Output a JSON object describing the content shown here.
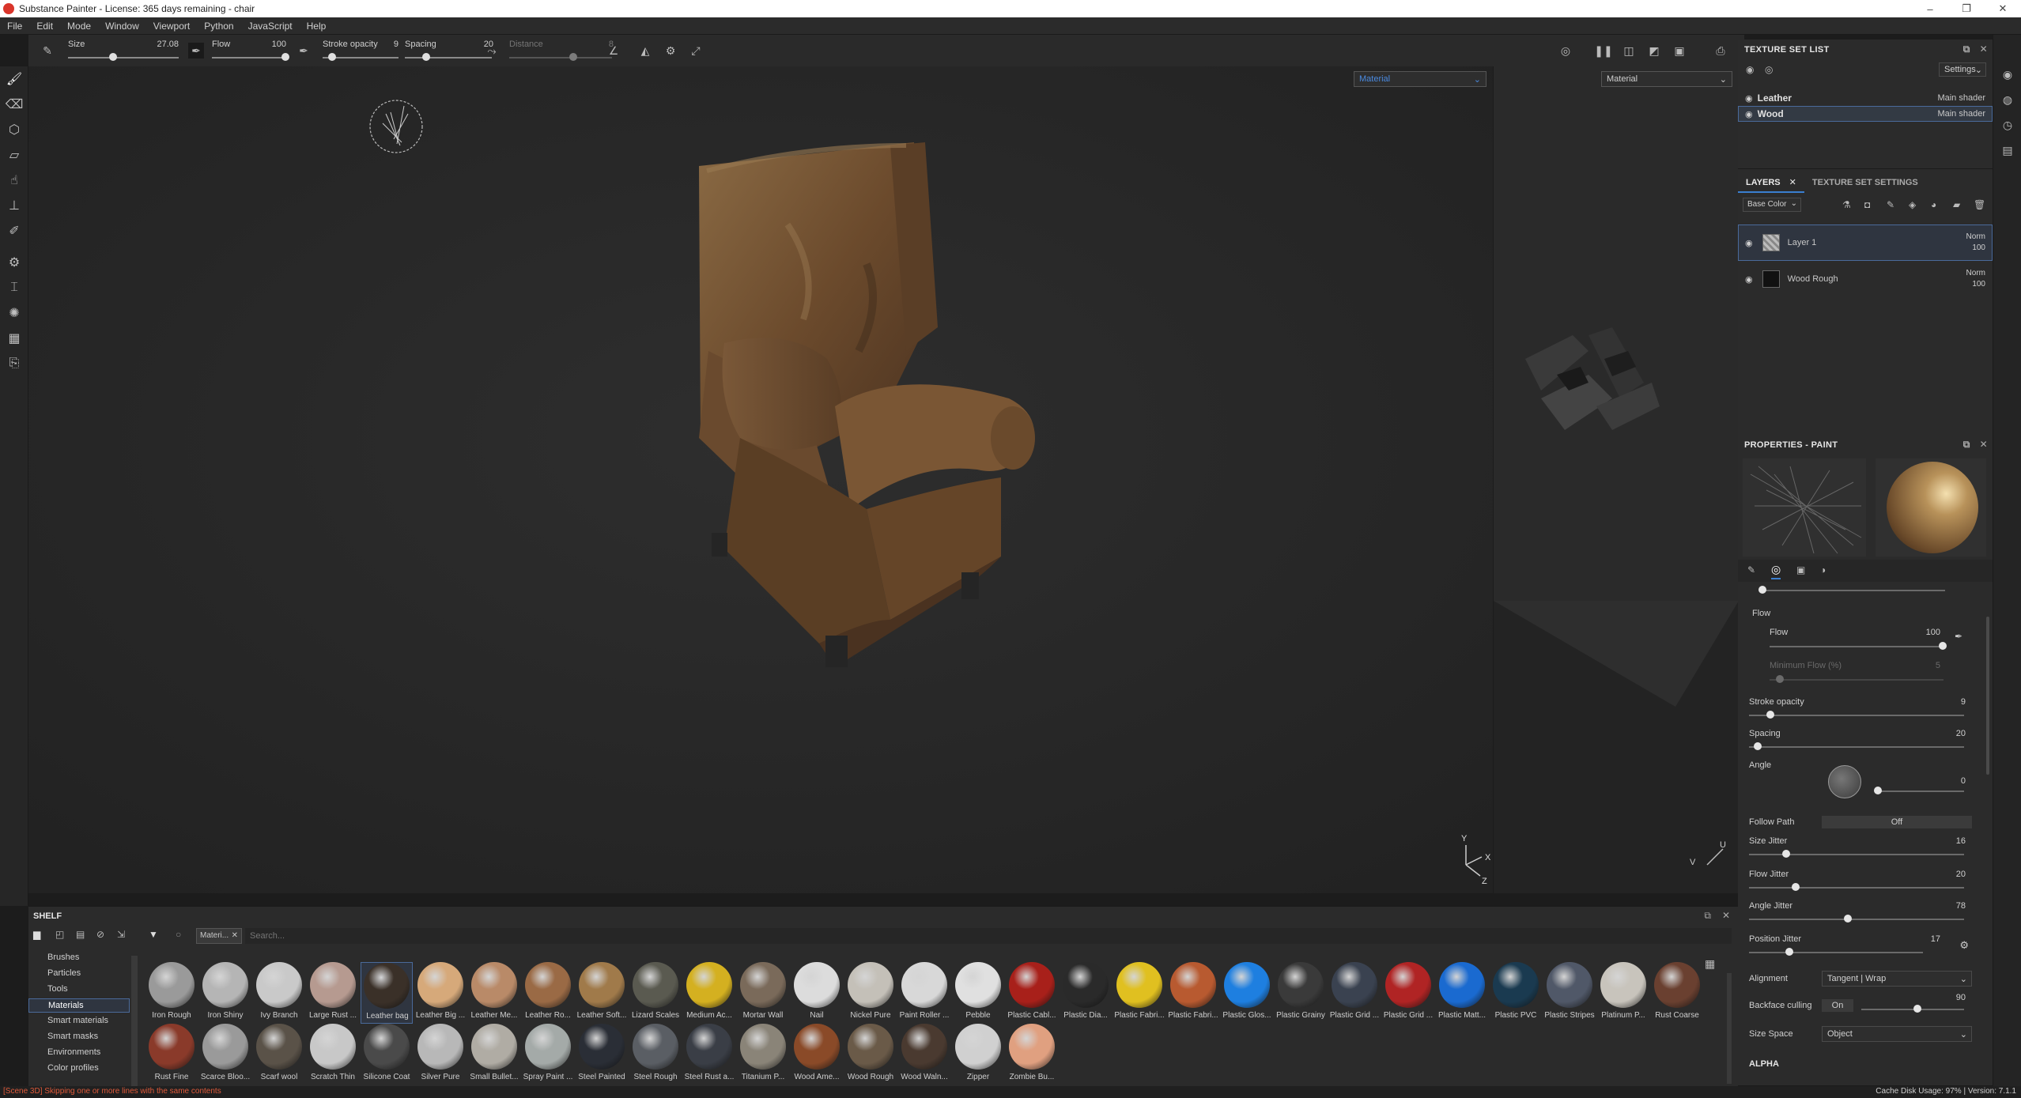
{
  "window": {
    "title": "Substance Painter - License: 365 days remaining - chair",
    "controls": [
      "–",
      "❐",
      "✕"
    ]
  },
  "menu": [
    "File",
    "Edit",
    "Mode",
    "Window",
    "Viewport",
    "Python",
    "JavaScript",
    "Help"
  ],
  "toolbar": {
    "size_label": "Size",
    "size_value": "27.08",
    "size_fraction": 0.45,
    "flow_label": "Flow",
    "flow_value": "100",
    "flow_fraction": 1.0,
    "stroke_opacity_label": "Stroke opacity",
    "stroke_opacity_value": "9",
    "stroke_opacity_fraction": 0.09,
    "spacing_label": "Spacing",
    "spacing_value": "20",
    "spacing_fraction": 0.2,
    "distance_label": "Distance",
    "distance_value": "8"
  },
  "viewport": {
    "left_mode": "Material",
    "right_mode": "Material",
    "axis_y": "Y",
    "axis_x": "X",
    "axis_z": "Z",
    "uv_v": "V",
    "uv_u": "U"
  },
  "texture_set_list": {
    "title": "TEXTURE SET LIST",
    "settings_label": "Settings",
    "sets": [
      {
        "name": "Leather",
        "shader": "Main shader"
      },
      {
        "name": "Wood",
        "shader": "Main shader"
      }
    ]
  },
  "layers_panel": {
    "tabs": [
      "LAYERS",
      "TEXTURE SET SETTINGS"
    ],
    "channel": "Base Color",
    "layers": [
      {
        "name": "Layer 1",
        "blend": "Norm",
        "opacity": "100"
      },
      {
        "name": "Wood Rough",
        "blend": "Norm",
        "opacity": "100"
      }
    ]
  },
  "properties": {
    "title": "PROPERTIES - PAINT",
    "flow_section": "Flow",
    "flow_label": "Flow",
    "flow_value": "100",
    "min_flow_label": "Minimum Flow (%)",
    "min_flow_value": "5",
    "stroke_opacity_label": "Stroke opacity",
    "stroke_opacity_value": "9",
    "spacing_label": "Spacing",
    "spacing_value": "20",
    "angle_label": "Angle",
    "angle_value": "0",
    "follow_path_label": "Follow Path",
    "follow_path_value": "Off",
    "size_jitter_label": "Size Jitter",
    "size_jitter_value": "16",
    "flow_jitter_label": "Flow Jitter",
    "flow_jitter_value": "20",
    "angle_jitter_label": "Angle Jitter",
    "angle_jitter_value": "78",
    "position_jitter_label": "Position Jitter",
    "position_jitter_value": "17",
    "alignment_label": "Alignment",
    "alignment_value": "Tangent | Wrap",
    "backface_label": "Backface culling",
    "backface_toggle": "On",
    "backface_value": "90",
    "size_space_label": "Size Space",
    "size_space_value": "Object",
    "alpha_section": "ALPHA"
  },
  "shelf": {
    "title": "SHELF",
    "filter_chip": "Materi...",
    "search_placeholder": "Search...",
    "categories": [
      "Brushes",
      "Particles",
      "Tools",
      "Materials",
      "Smart materials",
      "Smart masks",
      "Environments",
      "Color profiles"
    ],
    "selected_category": "Materials",
    "row1": [
      {
        "name": "Iron Rough",
        "color": "#9a9a9a"
      },
      {
        "name": "Iron Shiny",
        "color": "#b5b5b5"
      },
      {
        "name": "Ivy Branch",
        "color": "#c9c9c9"
      },
      {
        "name": "Large Rust ...",
        "color": "#b69a90"
      },
      {
        "name": "Leather bag",
        "color": "#3a3028"
      },
      {
        "name": "Leather Big ...",
        "color": "#d6a97a"
      },
      {
        "name": "Leather Me...",
        "color": "#b98a68"
      },
      {
        "name": "Leather Ro...",
        "color": "#9a6a45"
      },
      {
        "name": "Leather Soft...",
        "color": "#a07a4a"
      },
      {
        "name": "Lizard Scales",
        "color": "#5a5a50"
      },
      {
        "name": "Medium Ac...",
        "color": "#d4b020"
      },
      {
        "name": "Mortar Wall",
        "color": "#7a6a5a"
      },
      {
        "name": "Nail",
        "color": "#dcdcdc"
      },
      {
        "name": "Nickel Pure",
        "color": "#c4c0b8"
      },
      {
        "name": "Paint Roller ...",
        "color": "#d8d8d8"
      },
      {
        "name": "Pebble",
        "color": "#e0e0e0"
      },
      {
        "name": "Plastic Cabl...",
        "color": "#a8201a"
      },
      {
        "name": "Plastic Dia...",
        "color": "#2a2a2a"
      },
      {
        "name": "Plastic Fabri...",
        "color": "#e0c020"
      },
      {
        "name": "Plastic Fabri...",
        "color": "#b85a30"
      },
      {
        "name": "Plastic Glos...",
        "color": "#1e7fe0"
      },
      {
        "name": "Plastic Grainy",
        "color": "#3a3a3a"
      },
      {
        "name": "Plastic Grid ...",
        "color": "#3a4250"
      },
      {
        "name": "Plastic Grid ...",
        "color": "#b02424"
      },
      {
        "name": "Plastic Matt...",
        "color": "#1a6ad0"
      },
      {
        "name": "Plastic PVC",
        "color": "#1a3a50"
      },
      {
        "name": "Plastic Stripes",
        "color": "#505868"
      },
      {
        "name": "Platinum P...",
        "color": "#c8c4bc"
      },
      {
        "name": "Rust Coarse",
        "color": "#6a4030"
      }
    ],
    "row2": [
      {
        "name": "Rust Fine",
        "color": "#8a3a2a"
      },
      {
        "name": "Scarce Bloo...",
        "color": "#9a9a9a"
      },
      {
        "name": "Scarf wool",
        "color": "#5a5248"
      },
      {
        "name": "Scratch Thin",
        "color": "#c8c8c8"
      },
      {
        "name": "Silicone Coat",
        "color": "#4a4a4a"
      },
      {
        "name": "Silver Pure",
        "color": "#b8b8b8"
      },
      {
        "name": "Small Bullet...",
        "color": "#b0aca4"
      },
      {
        "name": "Spray Paint ...",
        "color": "#a4aaa8"
      },
      {
        "name": "Steel Painted",
        "color": "#2a2e36"
      },
      {
        "name": "Steel Rough",
        "color": "#5a5e64"
      },
      {
        "name": "Steel Rust a...",
        "color": "#3a3e46"
      },
      {
        "name": "Titanium P...",
        "color": "#8a8478"
      },
      {
        "name": "Wood Ame...",
        "color": "#8a4a28"
      },
      {
        "name": "Wood Rough",
        "color": "#6a5a48"
      },
      {
        "name": "Wood Waln...",
        "color": "#4a3a30"
      },
      {
        "name": "Zipper",
        "color": "#d0d0d0"
      },
      {
        "name": "Zombie Bu...",
        "color": "#e0a080"
      }
    ]
  },
  "status": {
    "message": "[Scene 3D] Skipping one or more lines with the same contents",
    "cache": "Cache Disk Usage:   97% | Version: 7.1.1"
  },
  "colors": {
    "accent": "#3a7fd0",
    "selection_border": "#4a6a9a",
    "error_text": "#e05a3a",
    "chair_brown": "#6b4a2c"
  }
}
